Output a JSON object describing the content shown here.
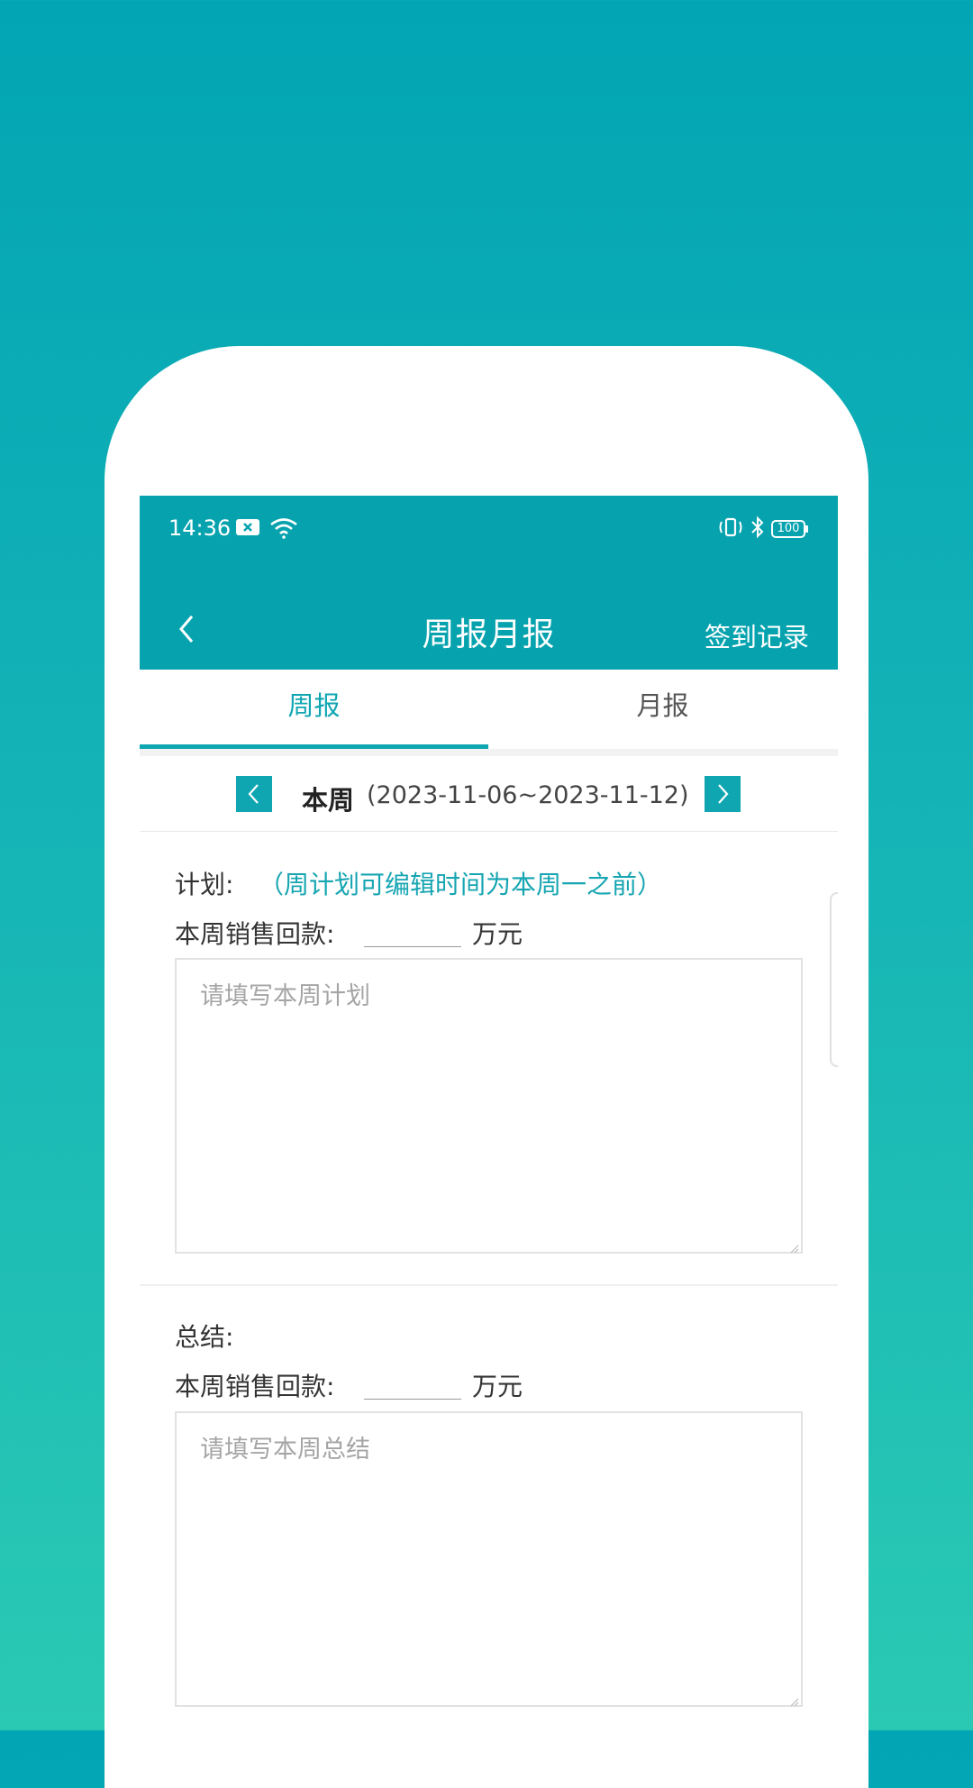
{
  "status_bar": {
    "time": "14:36",
    "battery": "100"
  },
  "nav": {
    "title": "周报月报",
    "action": "签到记录"
  },
  "tabs": [
    {
      "label": "周报",
      "active": true
    },
    {
      "label": "月报",
      "active": false
    }
  ],
  "week": {
    "label": "本周",
    "range": "(2023-11-06~2023-11-12)"
  },
  "plan": {
    "label": "计划:",
    "hint": "（周计划可编辑时间为本周一之前）",
    "amount_label": "本周销售回款:",
    "amount_value": "",
    "unit": "万元",
    "placeholder": "请填写本周计划"
  },
  "summary": {
    "label": "总结:",
    "amount_label": "本周销售回款:",
    "amount_value": "",
    "unit": "万元",
    "placeholder": "请填写本周总结"
  },
  "colors": {
    "accent": "#06A3AF",
    "tab_active": "#0FA6B2",
    "background_top": "#02A5B4",
    "background_bottom": "#2AC9B4"
  }
}
